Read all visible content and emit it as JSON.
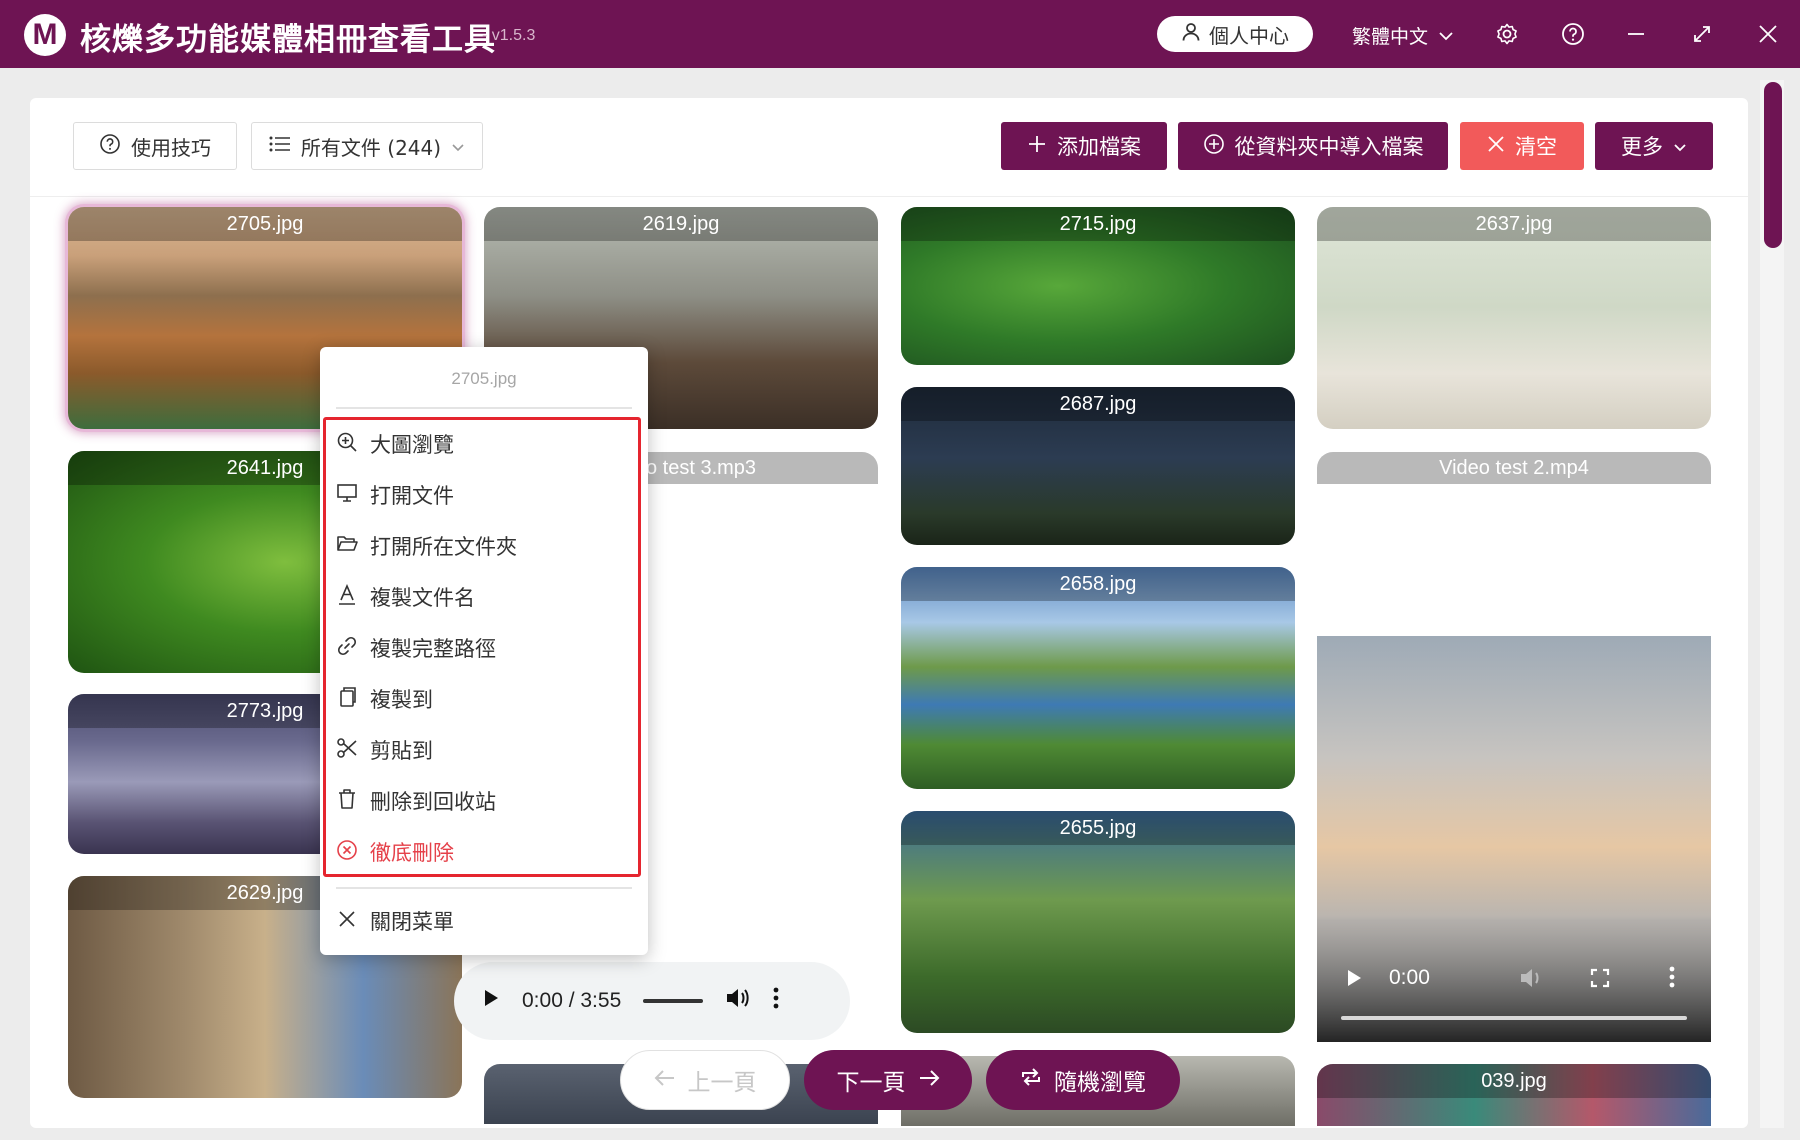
{
  "app": {
    "logo_letter": "M",
    "title": "核爍多功能媒體相冊查看工具",
    "version": "- v1.5.3"
  },
  "titlebar": {
    "user_center": "個人中心",
    "language": "繁體中文",
    "icons": [
      "user-icon",
      "chevron-down-icon",
      "gear-icon",
      "help-icon",
      "minimize-icon",
      "maximize-icon",
      "close-icon"
    ]
  },
  "toolbar": {
    "tips_label": "使用技巧",
    "filter_label": "所有文件 (244)",
    "add_files_label": "添加檔案",
    "import_folder_label": "從資料夾中導入檔案",
    "clear_label": "清空",
    "more_label": "更多"
  },
  "colors": {
    "brand": "#6e1453",
    "danger": "#f25a5a",
    "menu_border": "#e5252f",
    "danger_text": "#e5414a"
  },
  "cards": {
    "c2705": "2705.jpg",
    "c2619": "2619.jpg",
    "c2715": "2715.jpg",
    "c2637": "2637.jpg",
    "c2641": "2641.jpg",
    "audio3": "Audio test 3.mp3",
    "c2687": "2687.jpg",
    "video2": "Video test 2.mp4",
    "c2773": "2773.jpg",
    "c2658": "2658.jpg",
    "c2629": "2629.jpg",
    "c2655": "2655.jpg",
    "c039": "039.jpg"
  },
  "audio_player": {
    "time": "0:00 / 3:55"
  },
  "video_player": {
    "time": "0:00"
  },
  "context_menu": {
    "title": "2705.jpg",
    "items": [
      {
        "label": "大圖瀏覽",
        "icon": "zoom-in-icon"
      },
      {
        "label": "打開文件",
        "icon": "monitor-icon"
      },
      {
        "label": "打開所在文件夾",
        "icon": "folder-open-icon"
      },
      {
        "label": "複製文件名",
        "icon": "text-icon"
      },
      {
        "label": "複製完整路徑",
        "icon": "link-icon"
      },
      {
        "label": "複製到",
        "icon": "copy-icon"
      },
      {
        "label": "剪貼到",
        "icon": "scissors-icon"
      },
      {
        "label": "刪除到回收站",
        "icon": "trash-icon"
      },
      {
        "label": "徹底刪除",
        "icon": "circle-x-icon"
      }
    ],
    "close_label": "關閉菜單"
  },
  "pager": {
    "prev_label": "上一頁",
    "next_label": "下一頁",
    "random_label": "隨機瀏覽"
  }
}
